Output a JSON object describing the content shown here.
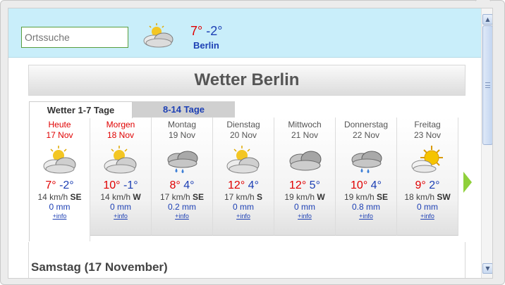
{
  "search": {
    "placeholder": "Ortssuche"
  },
  "current": {
    "icon": "partly-cloudy-icon",
    "high": "7°",
    "low": "-2°",
    "city": "Berlin"
  },
  "title": "Wetter Berlin",
  "tabs": [
    {
      "label": "Wetter 1-7 Tage"
    },
    {
      "label": "8-14 Tage"
    }
  ],
  "days": [
    {
      "name": "Heute",
      "date": "17 Nov",
      "icon": "partly-cloudy-icon",
      "high": "7°",
      "low": "-2°",
      "wind_speed": "14 km/h",
      "wind_dir": "SE",
      "precip": "0 mm",
      "info": "+info"
    },
    {
      "name": "Morgen",
      "date": "18 Nov",
      "icon": "partly-cloudy-icon",
      "high": "10°",
      "low": "-1°",
      "wind_speed": "14 km/h",
      "wind_dir": "W",
      "precip": "0 mm",
      "info": "+info"
    },
    {
      "name": "Montag",
      "date": "19 Nov",
      "icon": "rain-cloud-icon",
      "high": "8°",
      "low": "4°",
      "wind_speed": "17 km/h",
      "wind_dir": "SE",
      "precip": "0.2 mm",
      "info": "+info"
    },
    {
      "name": "Dienstag",
      "date": "20 Nov",
      "icon": "partly-cloudy-icon",
      "high": "12°",
      "low": "4°",
      "wind_speed": "17 km/h",
      "wind_dir": "S",
      "precip": "0 mm",
      "info": "+info"
    },
    {
      "name": "Mittwoch",
      "date": "21 Nov",
      "icon": "cloudy-icon",
      "high": "12°",
      "low": "5°",
      "wind_speed": "19 km/h",
      "wind_dir": "W",
      "precip": "0 mm",
      "info": "+info"
    },
    {
      "name": "Donnerstag",
      "date": "22 Nov",
      "icon": "rain-cloud-icon",
      "high": "10°",
      "low": "4°",
      "wind_speed": "19 km/h",
      "wind_dir": "SE",
      "precip": "0.8 mm",
      "info": "+info"
    },
    {
      "name": "Freitag",
      "date": "23 Nov",
      "icon": "sunny-cloud-icon",
      "high": "9°",
      "low": "2°",
      "wind_speed": "18 km/h",
      "wind_dir": "SW",
      "precip": "0 mm",
      "info": "+info"
    }
  ],
  "section": {
    "title": "Samstag (17 November)"
  },
  "colors": {
    "header_bg": "#c9eefa",
    "temp_high": "#e00000",
    "temp_low": "#1c3fb4",
    "accent_arrow": "#8fd03a"
  }
}
